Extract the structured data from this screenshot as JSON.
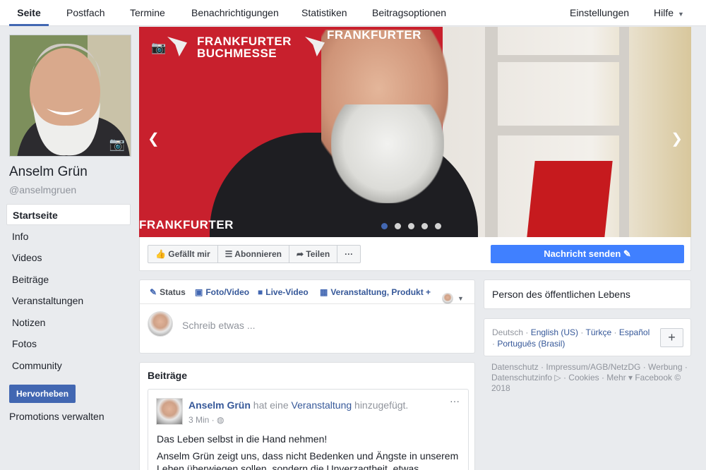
{
  "topnav": {
    "tabs": [
      "Seite",
      "Postfach",
      "Termine",
      "Benachrichtigungen",
      "Statistiken",
      "Beitragsoptionen"
    ],
    "settings": "Einstellungen",
    "help": "Hilfe"
  },
  "profile": {
    "name": "Anselm Grün",
    "handle": "@anselmgruen"
  },
  "sidebar": {
    "items": [
      "Startseite",
      "Info",
      "Videos",
      "Beiträge",
      "Veranstaltungen",
      "Notizen",
      "Fotos",
      "Community"
    ],
    "promote_button": "Hervorheben",
    "promotions_link": "Promotions verwalten"
  },
  "cover": {
    "logo_lines": [
      "FRANKFURTER",
      "BUCHMESSE"
    ],
    "logo_partial": "FRANKFURTER",
    "slide_count": 5,
    "active_slide": 1
  },
  "actions": {
    "like": "Gefällt mir",
    "subscribe": "Abonnieren",
    "share": "Teilen",
    "more": "···",
    "message": "Nachricht senden"
  },
  "composer": {
    "tabs": [
      "Status",
      "Foto/Video",
      "Live-Video",
      "Veranstaltung, Produkt +"
    ],
    "placeholder": "Schreib etwas ..."
  },
  "feed": {
    "title": "Beiträge",
    "post": {
      "author": "Anselm Grün",
      "action_pre": "hat eine",
      "action_link": "Veranstaltung",
      "action_post": "hinzugefügt.",
      "time": "3 Min",
      "more": "···",
      "text1": "Das Leben selbst in die Hand nehmen!",
      "text2": "Anselm Grün zeigt uns, dass nicht Bedenken und Ängste in unserem Leben überwiegen sollen, sondern die Unverzagtheit, etwas"
    }
  },
  "right": {
    "category": "Person des öffentlichen Lebens",
    "languages": {
      "current": "Deutsch",
      "links": [
        "English (US)",
        "Türkçe",
        "Español",
        "Português (Brasil)"
      ]
    },
    "footer": "Datenschutz · Impressum/AGB/NetzDG · Werbung · Datenschutzinfo ▷ · Cookies · Mehr ▾ Facebook © 2018"
  },
  "colors": {
    "accent": "#4267b2",
    "message_button": "#4080ff",
    "cover_red": "#c8202d"
  }
}
